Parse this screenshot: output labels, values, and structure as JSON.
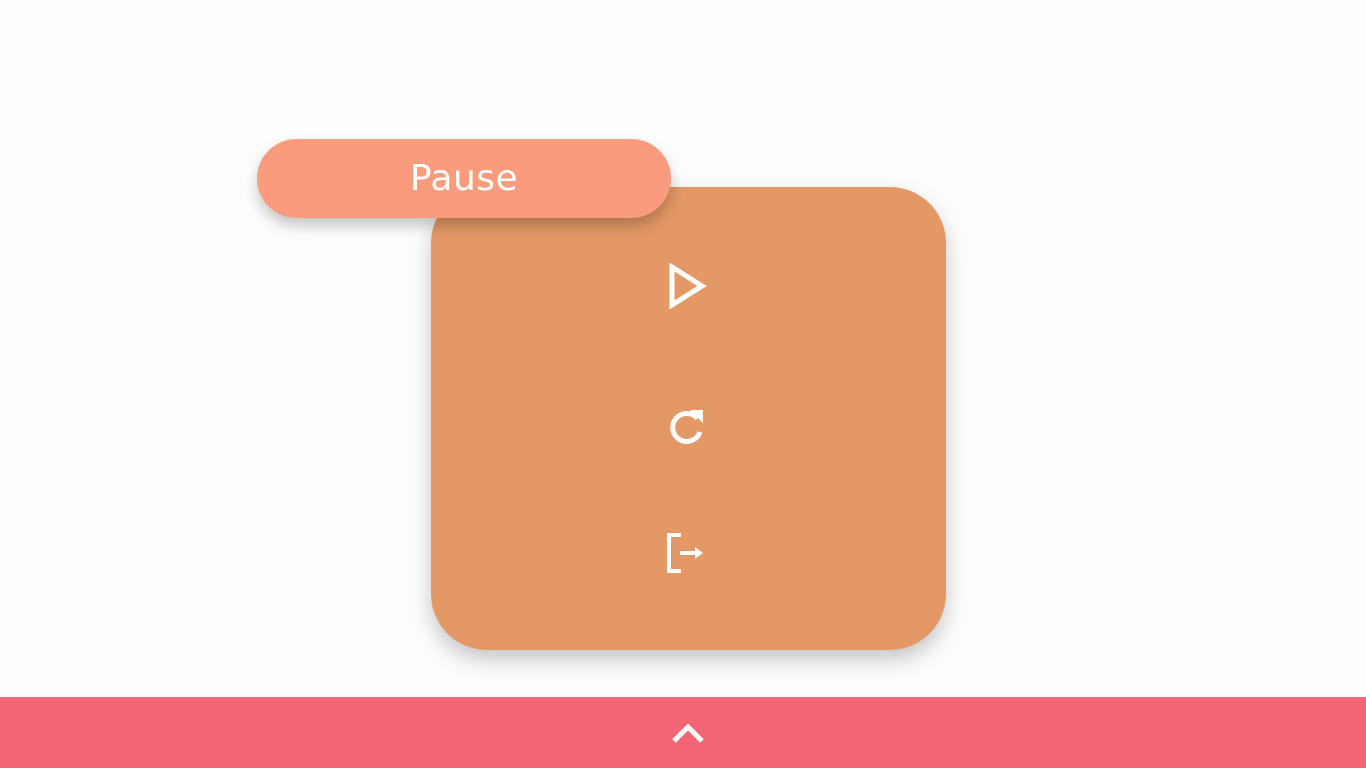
{
  "pause_menu": {
    "title": "Pause",
    "card_color": "#e39866",
    "title_color": "#f99b7d",
    "buttons": [
      {
        "name": "resume",
        "icon": "play-icon"
      },
      {
        "name": "restart",
        "icon": "restart-icon"
      },
      {
        "name": "exit",
        "icon": "exit-icon"
      }
    ]
  },
  "bottom_bar": {
    "color": "#f26574",
    "icon": "chevron-up-icon"
  }
}
